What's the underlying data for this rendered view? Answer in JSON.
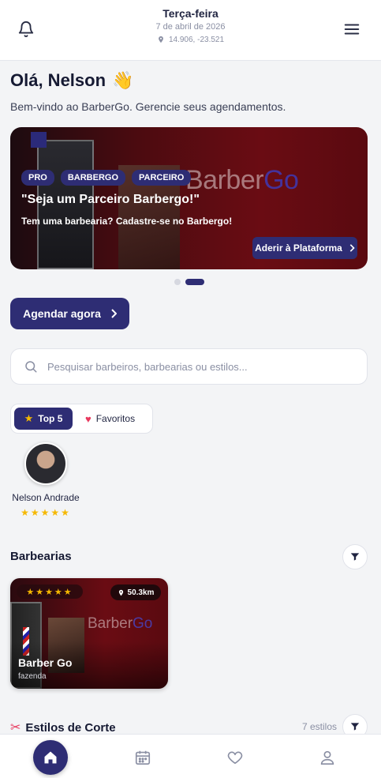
{
  "header": {
    "day": "Terça-feira",
    "date": "7 de abril de 2026",
    "coords": "14.906, -23.521"
  },
  "greeting": {
    "title": "Olá, Nelson",
    "emoji": "👋",
    "subtitle": "Bem-vindo ao BarberGo. Gerencie seus agendamentos."
  },
  "banner": {
    "tags": [
      "PRO",
      "BARBERGO",
      "PARCEIRO"
    ],
    "title": "\"Seja um Parceiro Barbergo!\"",
    "description": "Tem uma barbearia? Cadastre-se no Barbergo!",
    "cta_label": "Aderir à Plataforma",
    "logo_main": "Barber",
    "logo_accent": "Go",
    "slides_total": 2,
    "active_slide": 2
  },
  "book_button": {
    "label": "Agendar agora"
  },
  "search": {
    "placeholder": "Pesquisar barbeiros, barbearias ou estilos..."
  },
  "filters": {
    "top5_label": "Top 5",
    "favorites_label": "Favoritos"
  },
  "top_barbers": [
    {
      "name": "Nelson Andrade",
      "stars": "★★★★★",
      "rating": 5
    }
  ],
  "barbershops_section": {
    "title": "Barbearias",
    "items": [
      {
        "name": "Barber Go",
        "location": "fazenda",
        "distance": "50.3km",
        "stars": "★★★★★",
        "rating": 5,
        "logo_main": "Barber",
        "logo_accent": "Go"
      }
    ]
  },
  "styles_section": {
    "title": "Estilos de Corte",
    "count": "7 estilos"
  },
  "colors": {
    "primary": "#2e2d74",
    "star": "#f5b800",
    "banner_red": "#6a0c13"
  }
}
